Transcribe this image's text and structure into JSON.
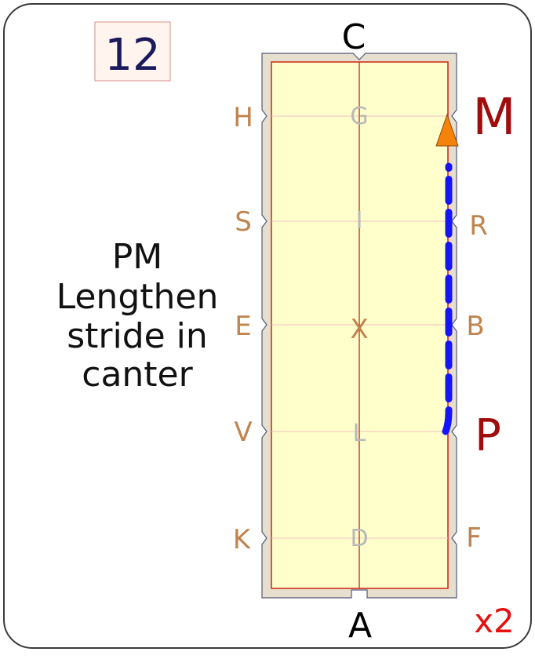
{
  "card": {
    "number": "12",
    "instruction_lines": [
      "PM",
      "Lengthen",
      "stride in",
      "canter"
    ],
    "repeat": "x2"
  },
  "arena": {
    "end_letters": {
      "top": "C",
      "bottom": "A"
    },
    "left_letters": [
      "H",
      "S",
      "E",
      "V",
      "K"
    ],
    "right_letters": [
      "R",
      "B",
      "F"
    ],
    "centerline_letters": [
      "G",
      "I",
      "X",
      "L",
      "D"
    ],
    "movement_start": "P",
    "movement_end": "M"
  },
  "colors": {
    "arena_fill": "#ffffcc",
    "arena_border": "#d2301f",
    "surround": "#e6dfcd",
    "marker_letter": "#c0844e",
    "centerline_letter": "#b8b8b8",
    "movement_letter": "#a00d0d",
    "path": "#1414ff",
    "arrow": "#f5820a",
    "number": "#1a1a5c",
    "number_box_fill": "#fff4ee",
    "number_box_border": "#d5908a",
    "repeat": "#e81010"
  }
}
